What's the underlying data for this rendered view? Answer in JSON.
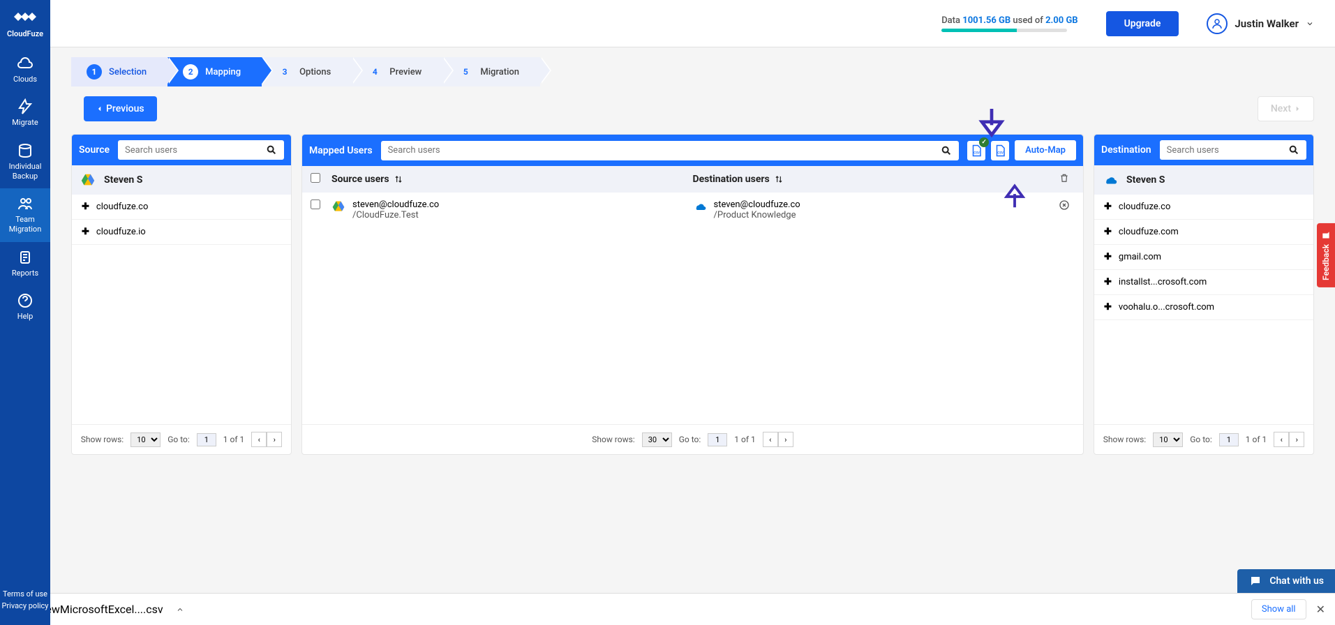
{
  "brand": "CloudFuze",
  "sidebar": {
    "items": [
      {
        "label": "Clouds"
      },
      {
        "label": "Migrate"
      },
      {
        "label": "Individual Backup"
      },
      {
        "label": "Team Migration"
      },
      {
        "label": "Reports"
      },
      {
        "label": "Help"
      }
    ],
    "bottom": {
      "terms": "Terms of use",
      "privacy": "Privacy policy"
    }
  },
  "topbar": {
    "data_label": "Data",
    "data_used": "1001.56 GB",
    "used_of": "used of",
    "data_total": "2.00 GB",
    "upgrade": "Upgrade",
    "user_name": "Justin Walker"
  },
  "stepper": [
    {
      "num": "1",
      "label": "Selection"
    },
    {
      "num": "2",
      "label": "Mapping"
    },
    {
      "num": "3",
      "label": "Options"
    },
    {
      "num": "4",
      "label": "Preview"
    },
    {
      "num": "5",
      "label": "Migration"
    }
  ],
  "nav": {
    "prev": "Previous",
    "next": "Next"
  },
  "source": {
    "title": "Source",
    "search_placeholder": "Search users",
    "account": "Steven S",
    "items": [
      "cloudfuze.co",
      "cloudfuze.io"
    ]
  },
  "mapped": {
    "title": "Mapped Users",
    "search_placeholder": "Search users",
    "auto_map": "Auto-Map",
    "col_source": "Source users",
    "col_dest": "Destination users",
    "rows": [
      {
        "source_email": "steven@cloudfuze.co",
        "source_path": "/CloudFuze.Test",
        "dest_email": "steven@cloudfuze.co",
        "dest_path": "/Product Knowledge"
      }
    ]
  },
  "destination": {
    "title": "Destination",
    "search_placeholder": "Search users",
    "account": "Steven S",
    "items": [
      "cloudfuze.co",
      "cloudfuze.com",
      "gmail.com",
      "installst...crosoft.com",
      "voohalu.o...crosoft.com"
    ]
  },
  "footer": {
    "show_rows": "Show rows:",
    "goto": "Go to:",
    "page_info": "1 of 1",
    "rows_10": "10",
    "rows_30": "30",
    "page_val": "1"
  },
  "feedback": "Feedback",
  "chat": "Chat with us",
  "download": {
    "file": "NewMicrosoftExcel....csv",
    "show_all": "Show all"
  }
}
